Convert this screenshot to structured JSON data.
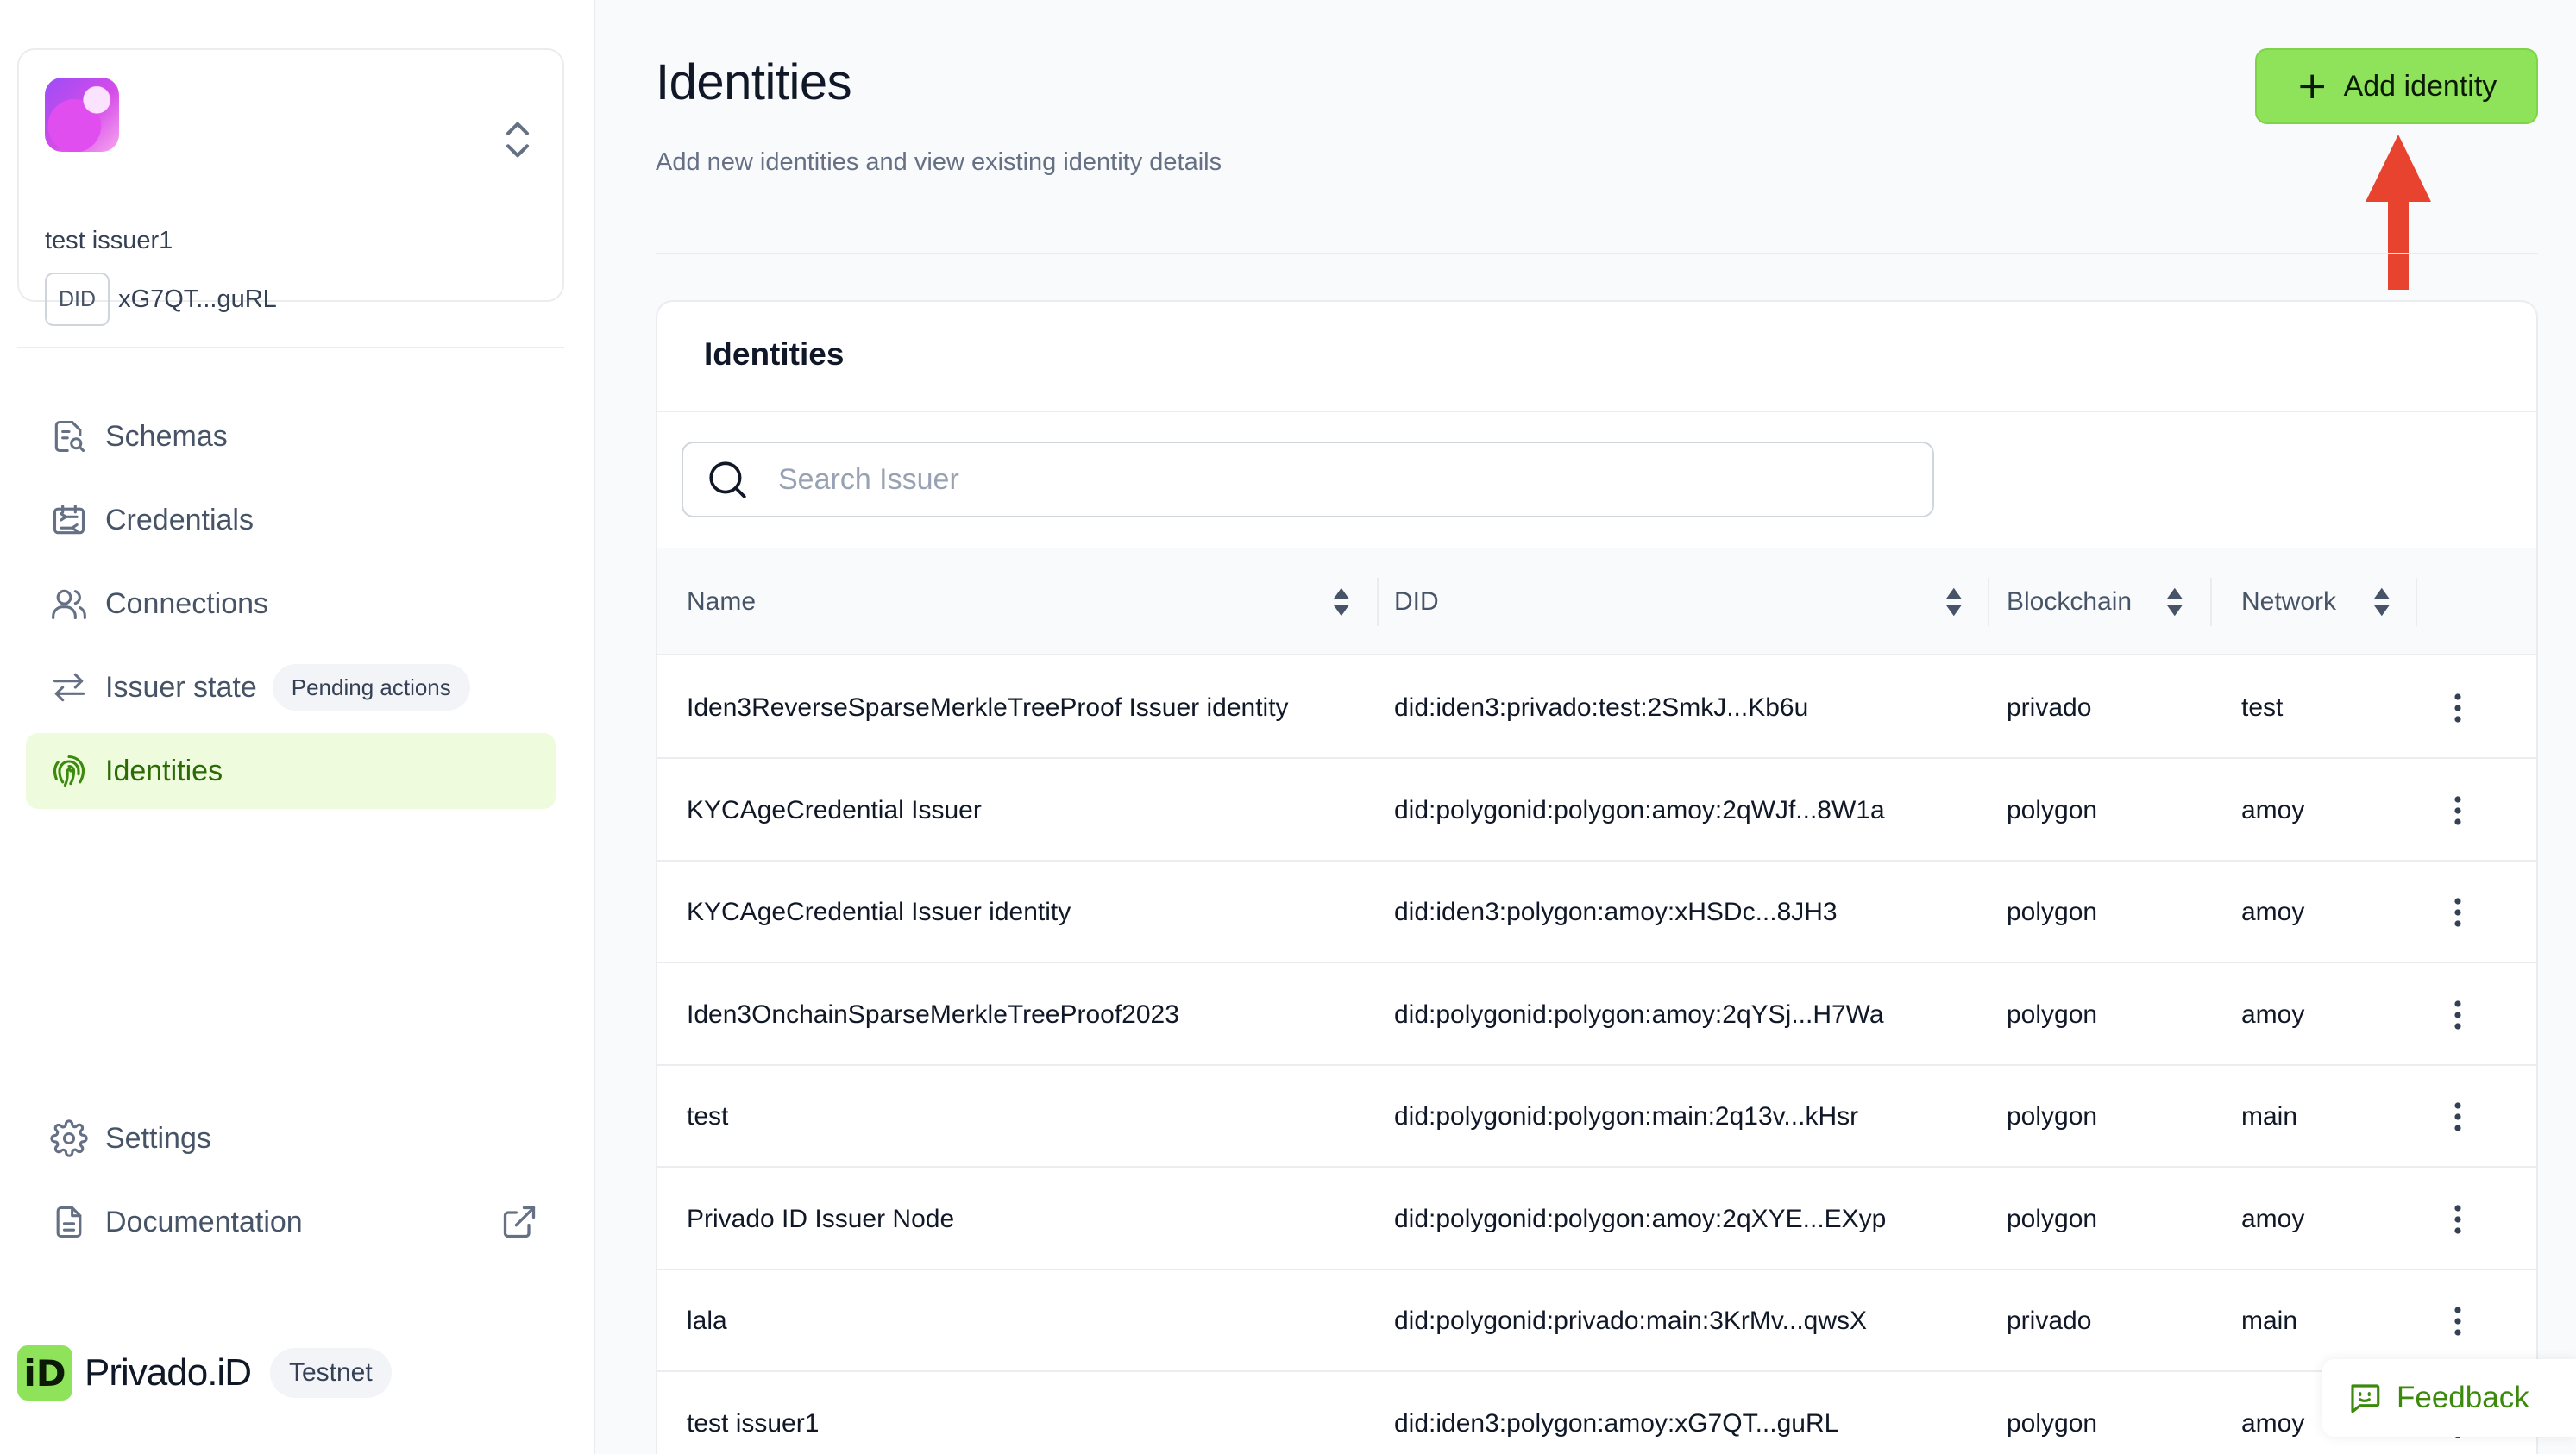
{
  "org": {
    "name": "test issuer1",
    "did_badge": "DID",
    "did_value": "xG7QT...guRL"
  },
  "nav": {
    "items": [
      {
        "label": "Schemas",
        "icon": "schema-icon"
      },
      {
        "label": "Credentials",
        "icon": "credentials-icon"
      },
      {
        "label": "Connections",
        "icon": "connections-icon"
      },
      {
        "label": "Issuer state",
        "icon": "transfer-arrows-icon",
        "pill": "Pending actions"
      },
      {
        "label": "Identities",
        "icon": "fingerprint-icon",
        "active": true
      }
    ],
    "bottom": [
      {
        "label": "Settings",
        "icon": "gear-icon"
      },
      {
        "label": "Documentation",
        "icon": "document-icon"
      }
    ]
  },
  "brand": {
    "mark": "iD",
    "name": "Privado.iD",
    "tag": "Testnet"
  },
  "header": {
    "title": "Identities",
    "subtitle": "Add new identities and view existing identity details",
    "add_button": "Add identity"
  },
  "card": {
    "title": "Identities",
    "search_placeholder": "Search Issuer"
  },
  "table": {
    "columns": [
      "Name",
      "DID",
      "Blockchain",
      "Network"
    ],
    "rows": [
      {
        "name": "Iden3ReverseSparseMerkleTreeProof Issuer identity",
        "did": "did:iden3:privado:test:2SmkJ...Kb6u",
        "blockchain": "privado",
        "network": "test"
      },
      {
        "name": "KYCAgeCredential Issuer",
        "did": "did:polygonid:polygon:amoy:2qWJf...8W1a",
        "blockchain": "polygon",
        "network": "amoy"
      },
      {
        "name": "KYCAgeCredential Issuer identity",
        "did": "did:iden3:polygon:amoy:xHSDc...8JH3",
        "blockchain": "polygon",
        "network": "amoy"
      },
      {
        "name": "Iden3OnchainSparseMerkleTreeProof2023",
        "did": "did:polygonid:polygon:amoy:2qYSj...H7Wa",
        "blockchain": "polygon",
        "network": "amoy"
      },
      {
        "name": "test",
        "did": "did:polygonid:polygon:main:2q13v...kHsr",
        "blockchain": "polygon",
        "network": "main"
      },
      {
        "name": "Privado ID Issuer Node",
        "did": "did:polygonid:polygon:amoy:2qXYE...EXyp",
        "blockchain": "polygon",
        "network": "amoy"
      },
      {
        "name": "lala",
        "did": "did:polygonid:privado:main:3KrMv...qwsX",
        "blockchain": "privado",
        "network": "main"
      },
      {
        "name": "test issuer1",
        "did": "did:iden3:polygon:amoy:xG7QT...guRL",
        "blockchain": "polygon",
        "network": "amoy"
      }
    ]
  },
  "feedback": {
    "label": "Feedback"
  },
  "colors": {
    "accent": "#8ee35a",
    "active_bg": "#eefbdd",
    "active_text": "#2d6a06",
    "annotation_arrow": "#e8432e"
  }
}
